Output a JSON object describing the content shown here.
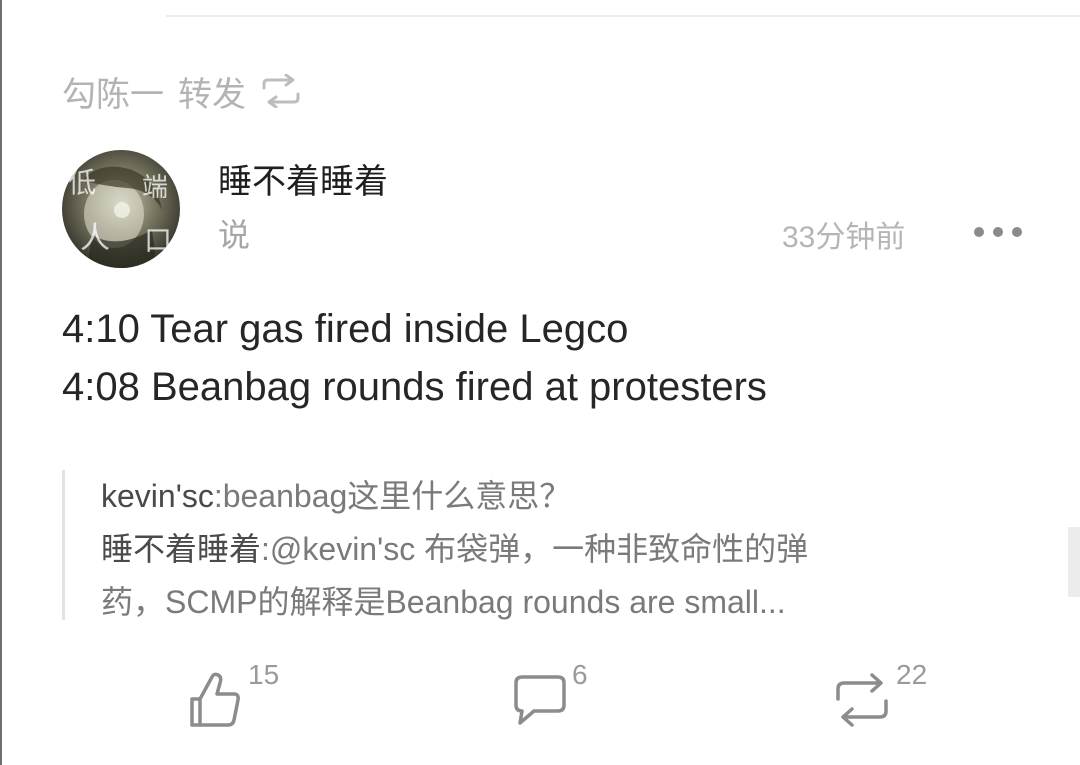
{
  "repost": {
    "user": "勾陈一",
    "action": "转发"
  },
  "post": {
    "author": "睡不着睡着",
    "verb": "说",
    "time": "33分钟前",
    "avatar_text": [
      "低",
      "端",
      "人",
      "口"
    ],
    "lines": [
      "4:10 Tear gas fired inside Legco",
      "4:08 Beanbag rounds fired at protesters"
    ]
  },
  "quote": {
    "line1_user": "kevin'sc",
    "line1_text": ":beanbag这里什么意思？",
    "line2_user": "睡不着睡着",
    "line2_text": ":@kevin'sc 布袋弹，一种非致命性的弹",
    "line3_text": "药，SCMP的解释是Beanbag rounds are small..."
  },
  "actions": {
    "likes": "15",
    "comments": "6",
    "reposts": "22"
  },
  "icons": {
    "repost": "retweet-icon",
    "more": "more-icon",
    "like": "thumbs-up-icon",
    "comment": "comment-icon",
    "retweet": "retweet-icon"
  }
}
